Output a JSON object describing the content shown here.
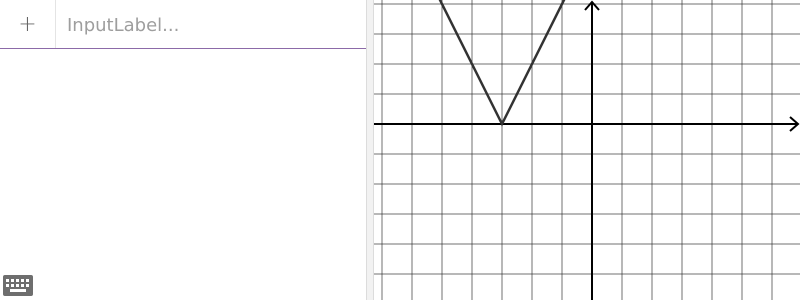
{
  "algebra": {
    "add_label": "+",
    "input_placeholder": "InputLabel..."
  },
  "icons": {
    "add": "plus-icon",
    "keyboard": "keyboard-icon"
  },
  "graph": {
    "function_color": "#333333",
    "grid_color": "#333333",
    "axis_color": "#000000",
    "grid_step": 1,
    "x_range": [
      -7,
      7
    ],
    "y_range": [
      -6,
      4
    ],
    "vertex": [
      -3,
      0
    ],
    "slope": 2
  }
}
